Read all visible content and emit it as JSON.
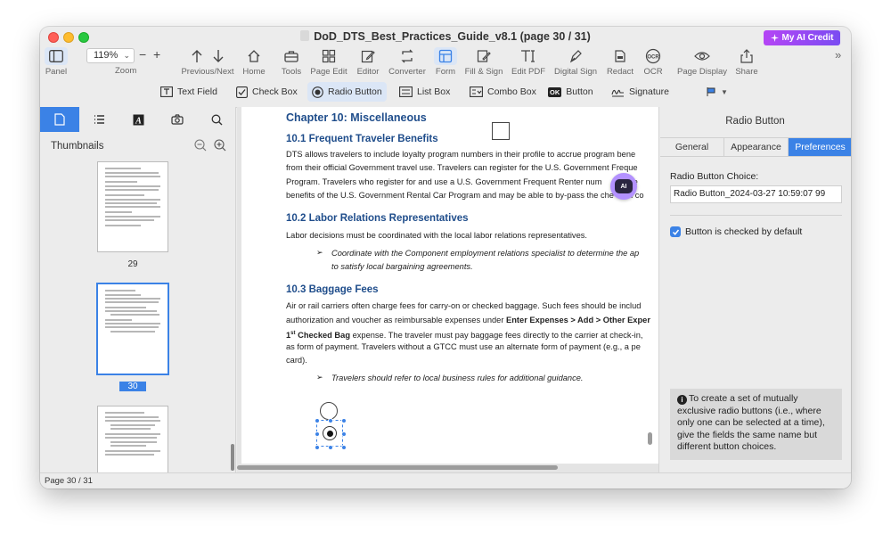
{
  "window": {
    "title": "DoD_DTS_Best_Practices_Guide_v8.1 (page 30 / 31)",
    "ai_credit_label": "My AI Credit"
  },
  "toolbar": {
    "panel": "Panel",
    "zoom_value": "119%",
    "zoom": "Zoom",
    "prev_next": "Previous/Next",
    "home": "Home",
    "tools": "Tools",
    "page_edit": "Page Edit",
    "editor": "Editor",
    "converter": "Converter",
    "form": "Form",
    "fill_sign": "Fill & Sign",
    "edit_pdf": "Edit PDF",
    "digital_sign": "Digital Sign",
    "redact": "Redact",
    "ocr": "OCR",
    "page_display": "Page Display",
    "share": "Share"
  },
  "formbar": {
    "text_field": "Text Field",
    "check_box": "Check Box",
    "radio_button": "Radio Button",
    "list_box": "List Box",
    "combo_box": "Combo Box",
    "button": "Button",
    "button_icon_text": "OK",
    "signature": "Signature"
  },
  "left_panel": {
    "title": "Thumbnails",
    "pages": [
      "29",
      "30"
    ]
  },
  "document": {
    "chapter": "Chapter 10: Miscellaneous",
    "s1_title": "10.1 Frequent Traveler Benefits",
    "s1_l1": "DTS allows travelers to include loyalty program numbers in their profile to accrue program bene",
    "s1_l2": "from their official Government travel use. Travelers can register for the U.S. Government Freque",
    "s1_l3": "Program. Travelers who register for and use a U.S. Government Frequent Renter num",
    "s1_l3b": "re",
    "s1_l4": "benefits of the U.S. Government Rental Car Program and may be able to by-pass the che",
    "s1_l4b": "in co",
    "s2_title": "10.2 Labor Relations Representatives",
    "s2_l1": "Labor decisions must be coordinated with the local labor relations representatives.",
    "s2_b1": "Coordinate with the Component employment relations specialist to determine the ap",
    "s2_b2": "to satisfy local bargaining agreements.",
    "s3_title": "10.3 Baggage Fees",
    "s3_l1": "Air or rail carriers often charge fees for carry-on or checked baggage. Such fees should be includ",
    "s3_l2a": "authorization and voucher as reimbursable expenses under ",
    "s3_l2b": "Enter Expenses > Add > Other Exper",
    "s3_l3a": "1",
    "s3_l3sup": "st",
    "s3_l3b": " Checked Bag",
    "s3_l3c": " expense. The traveler must pay baggage fees directly to the carrier at check-in,",
    "s3_l4": "as form of payment. Travelers without a GTCC must use an alternate form of payment (e.g., a pe",
    "s3_l5": "card).",
    "s3_b1": "Travelers should refer to local business rules for additional guidance.",
    "ai_badge": "AI"
  },
  "right_panel": {
    "title": "Radio Button",
    "tabs": [
      "General",
      "Appearance",
      "Preferences"
    ],
    "choice_label": "Radio Button Choice:",
    "choice_value": "Radio Button_2024-03-27 10:59:07 99",
    "checked_default": "Button is checked by default",
    "info_text": "To create a set of mutually exclusive radio buttons (i.e., where only one can be selected at a time), give the fields the same name but different button choices."
  },
  "status": {
    "page": "Page 30 / 31"
  }
}
